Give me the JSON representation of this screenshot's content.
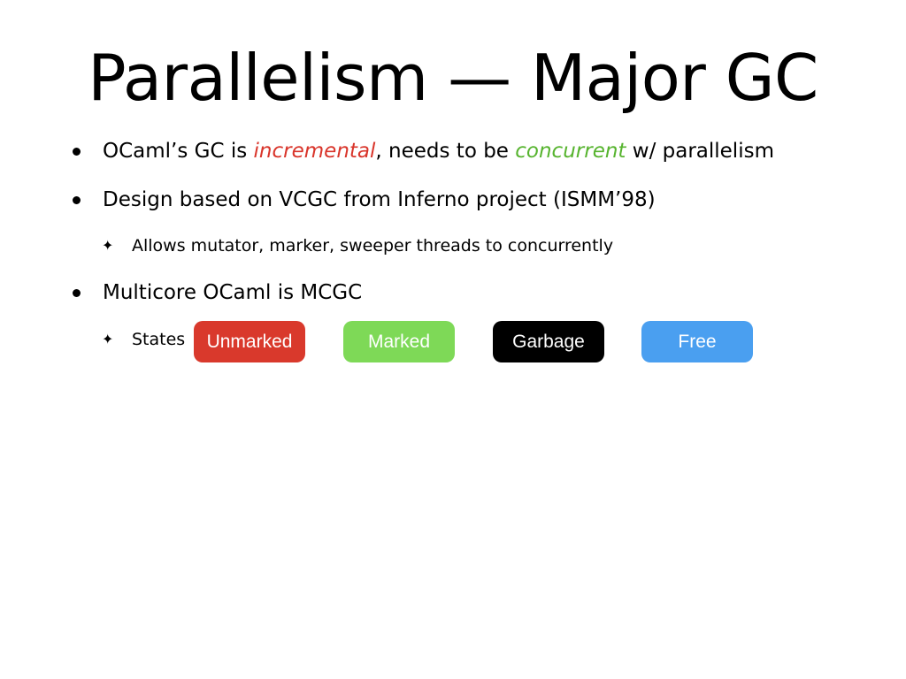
{
  "slide": {
    "title": "Parallelism — Major GC",
    "bullets": [
      {
        "parts": [
          "OCaml’s GC is ",
          "incremental",
          ", needs to be ",
          "concurrent",
          " w/ parallelism"
        ]
      },
      {
        "text": "Design based on VCGC from Inferno project (ISMM’98)",
        "sub": [
          "Allows mutator, marker, sweeper threads to concurrently"
        ]
      },
      {
        "text": "Multicore OCaml is MCGC",
        "sub": [
          "States"
        ]
      }
    ],
    "states": [
      {
        "label": "Unmarked",
        "color": "#d9392c"
      },
      {
        "label": "Marked",
        "color": "#7ed957"
      },
      {
        "label": "Garbage",
        "color": "#000000"
      },
      {
        "label": "Free",
        "color": "#4a9ff0"
      }
    ],
    "emphasis_colors": {
      "incremental": "#d9352b",
      "concurrent": "#57b42f"
    }
  }
}
